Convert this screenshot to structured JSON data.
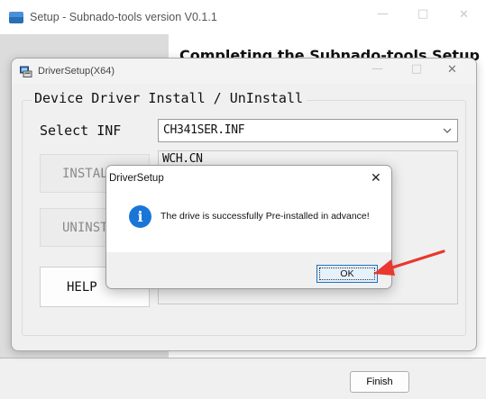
{
  "setup_window": {
    "title": "Setup - Subnado-tools version V0.1.1",
    "heading": "Completing the Subnado-tools Setup",
    "finish_label": "Finish",
    "caption": {
      "minimize": "—",
      "maximize": "□",
      "close": "✕"
    }
  },
  "driver_window": {
    "title": "DriverSetup(X64)",
    "group_title": "Device Driver Install / UnInstall",
    "select_label": "Select INF",
    "inf_selected": "CH341SER.INF",
    "info_text": "WCH.CN",
    "install_label": "INSTALL",
    "uninstall_label": "UNINSTALL",
    "help_label": "HELP",
    "caption": {
      "minimize": "—",
      "maximize": "□",
      "close": "✕"
    }
  },
  "message_box": {
    "title": "DriverSetup",
    "message": "The drive is successfully Pre-installed in advance!",
    "ok_label": "OK",
    "close_glyph": "✕",
    "icon_glyph": "i"
  },
  "icons": {
    "setup_app": "installer-icon",
    "driver_app": "driver-setup-icon",
    "dropdown": "chevron-down-icon",
    "info": "info-icon",
    "annotation": "red-arrow"
  },
  "colors": {
    "info_icon": "#1976d8",
    "ok_focus_border": "#1e70c8",
    "annotation_arrow": "#e8382f"
  }
}
